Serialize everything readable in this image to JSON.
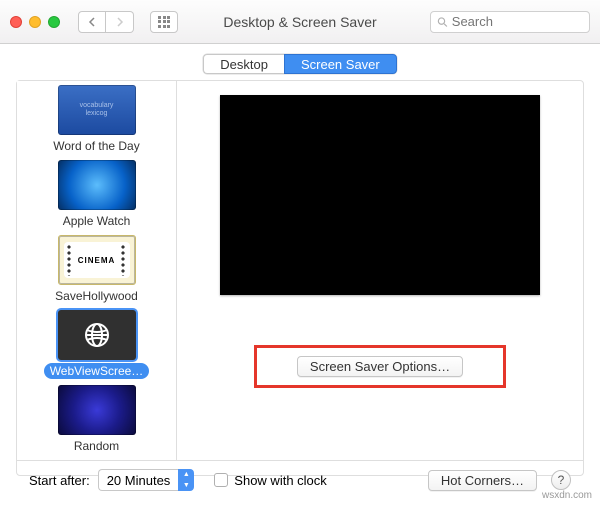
{
  "window": {
    "title": "Desktop & Screen Saver",
    "search_placeholder": "Search"
  },
  "tabs": {
    "desktop": "Desktop",
    "screensaver": "Screen Saver",
    "active": "Screen Saver"
  },
  "sidebar": {
    "items": [
      {
        "label": "Word of the Day",
        "kind": "word"
      },
      {
        "label": "Apple Watch",
        "kind": "watch"
      },
      {
        "label": "SaveHollywood",
        "kind": "cinema",
        "ticket": "CINEMA"
      },
      {
        "label": "WebViewScree…",
        "kind": "web",
        "selected": true
      },
      {
        "label": "Random",
        "kind": "rand"
      }
    ]
  },
  "main": {
    "options_button": "Screen Saver Options…"
  },
  "footer": {
    "start_after_label": "Start after:",
    "start_after_value": "20 Minutes",
    "show_with_clock": "Show with clock",
    "hot_corners": "Hot Corners…",
    "help": "?"
  },
  "watermark": "wsxdn.com"
}
